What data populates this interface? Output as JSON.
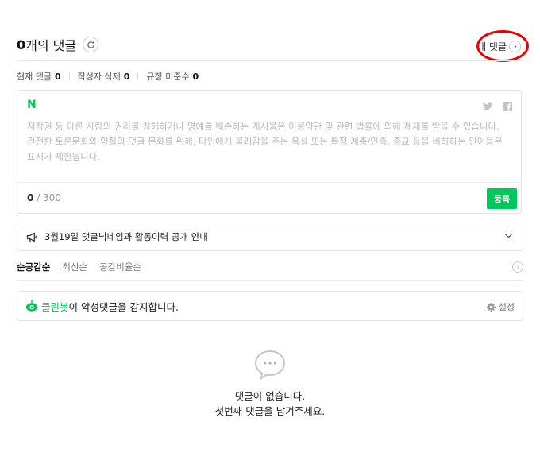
{
  "header": {
    "count_number": "0",
    "count_suffix": "개의 댓글",
    "my_comments_label": "내 댓글"
  },
  "stats": [
    {
      "label": "현재 댓글",
      "value": "0"
    },
    {
      "label": "작성자 삭제",
      "value": "0"
    },
    {
      "label": "규정 미준수",
      "value": "0"
    }
  ],
  "composer": {
    "logo": "N",
    "placeholder": "저작권 등 다른 사람의 권리를 침해하거나 명예를 훼손하는 게시물은 이용약관 및 관련 법률에 의해 제재를 받을 수 있습니다. 건전한 토론문화와 양질의 댓글 문화를 위해, 타인에게 불쾌감을 주는 욕설 또는 특정 계층/민족, 종교 등을 비하하는 단어들은 표시가 제한됩니다.",
    "char_current": "0",
    "char_max": "/ 300",
    "submit_label": "등록"
  },
  "notice": {
    "text": "3월19일 댓글닉네임과 활동이력 공개 안내"
  },
  "sort": {
    "options": [
      "순공감순",
      "최신순",
      "공감비율순"
    ],
    "active": 0,
    "info_glyph": "i"
  },
  "cleanbot": {
    "brand": "클린봇",
    "message": "이 악성댓글을 감지합니다.",
    "settings_label": "설정"
  },
  "empty": {
    "line1": "댓글이 없습니다.",
    "line2": "첫번째 댓글을 남겨주세요."
  },
  "colors": {
    "accent": "#03c75a",
    "highlight_circle": "#e00000"
  },
  "icons": {
    "refresh": "refresh-icon",
    "twitter": "twitter-icon",
    "facebook": "facebook-icon",
    "megaphone": "megaphone-icon",
    "chevron": "chevron-down-icon",
    "cleanbot": "cleanbot-icon",
    "gear": "gear-icon",
    "speech_bubble": "speech-bubble-icon"
  }
}
